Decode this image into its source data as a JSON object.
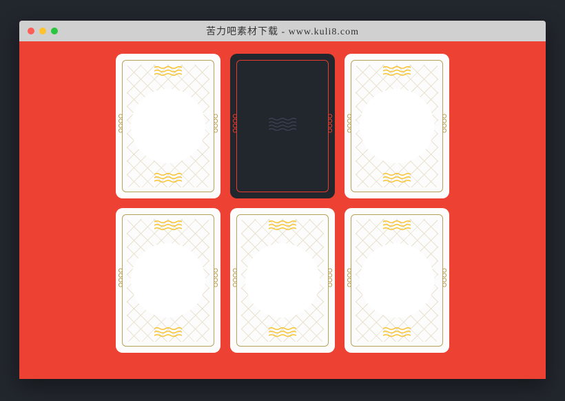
{
  "window": {
    "title": "苦力吧素材下载 - www.kuli8.com"
  },
  "colors": {
    "background": "#ed4233",
    "card_light": "#fcfcfc",
    "card_dark": "#22262d",
    "border_light": "#b7a15a",
    "border_dark": "#e73c2e",
    "wave_yellow": "#f8c331",
    "wave_dark": "#3a4050"
  },
  "cards": [
    {
      "style": "light"
    },
    {
      "style": "dark"
    },
    {
      "style": "light"
    },
    {
      "style": "light"
    },
    {
      "style": "light"
    },
    {
      "style": "light"
    }
  ]
}
